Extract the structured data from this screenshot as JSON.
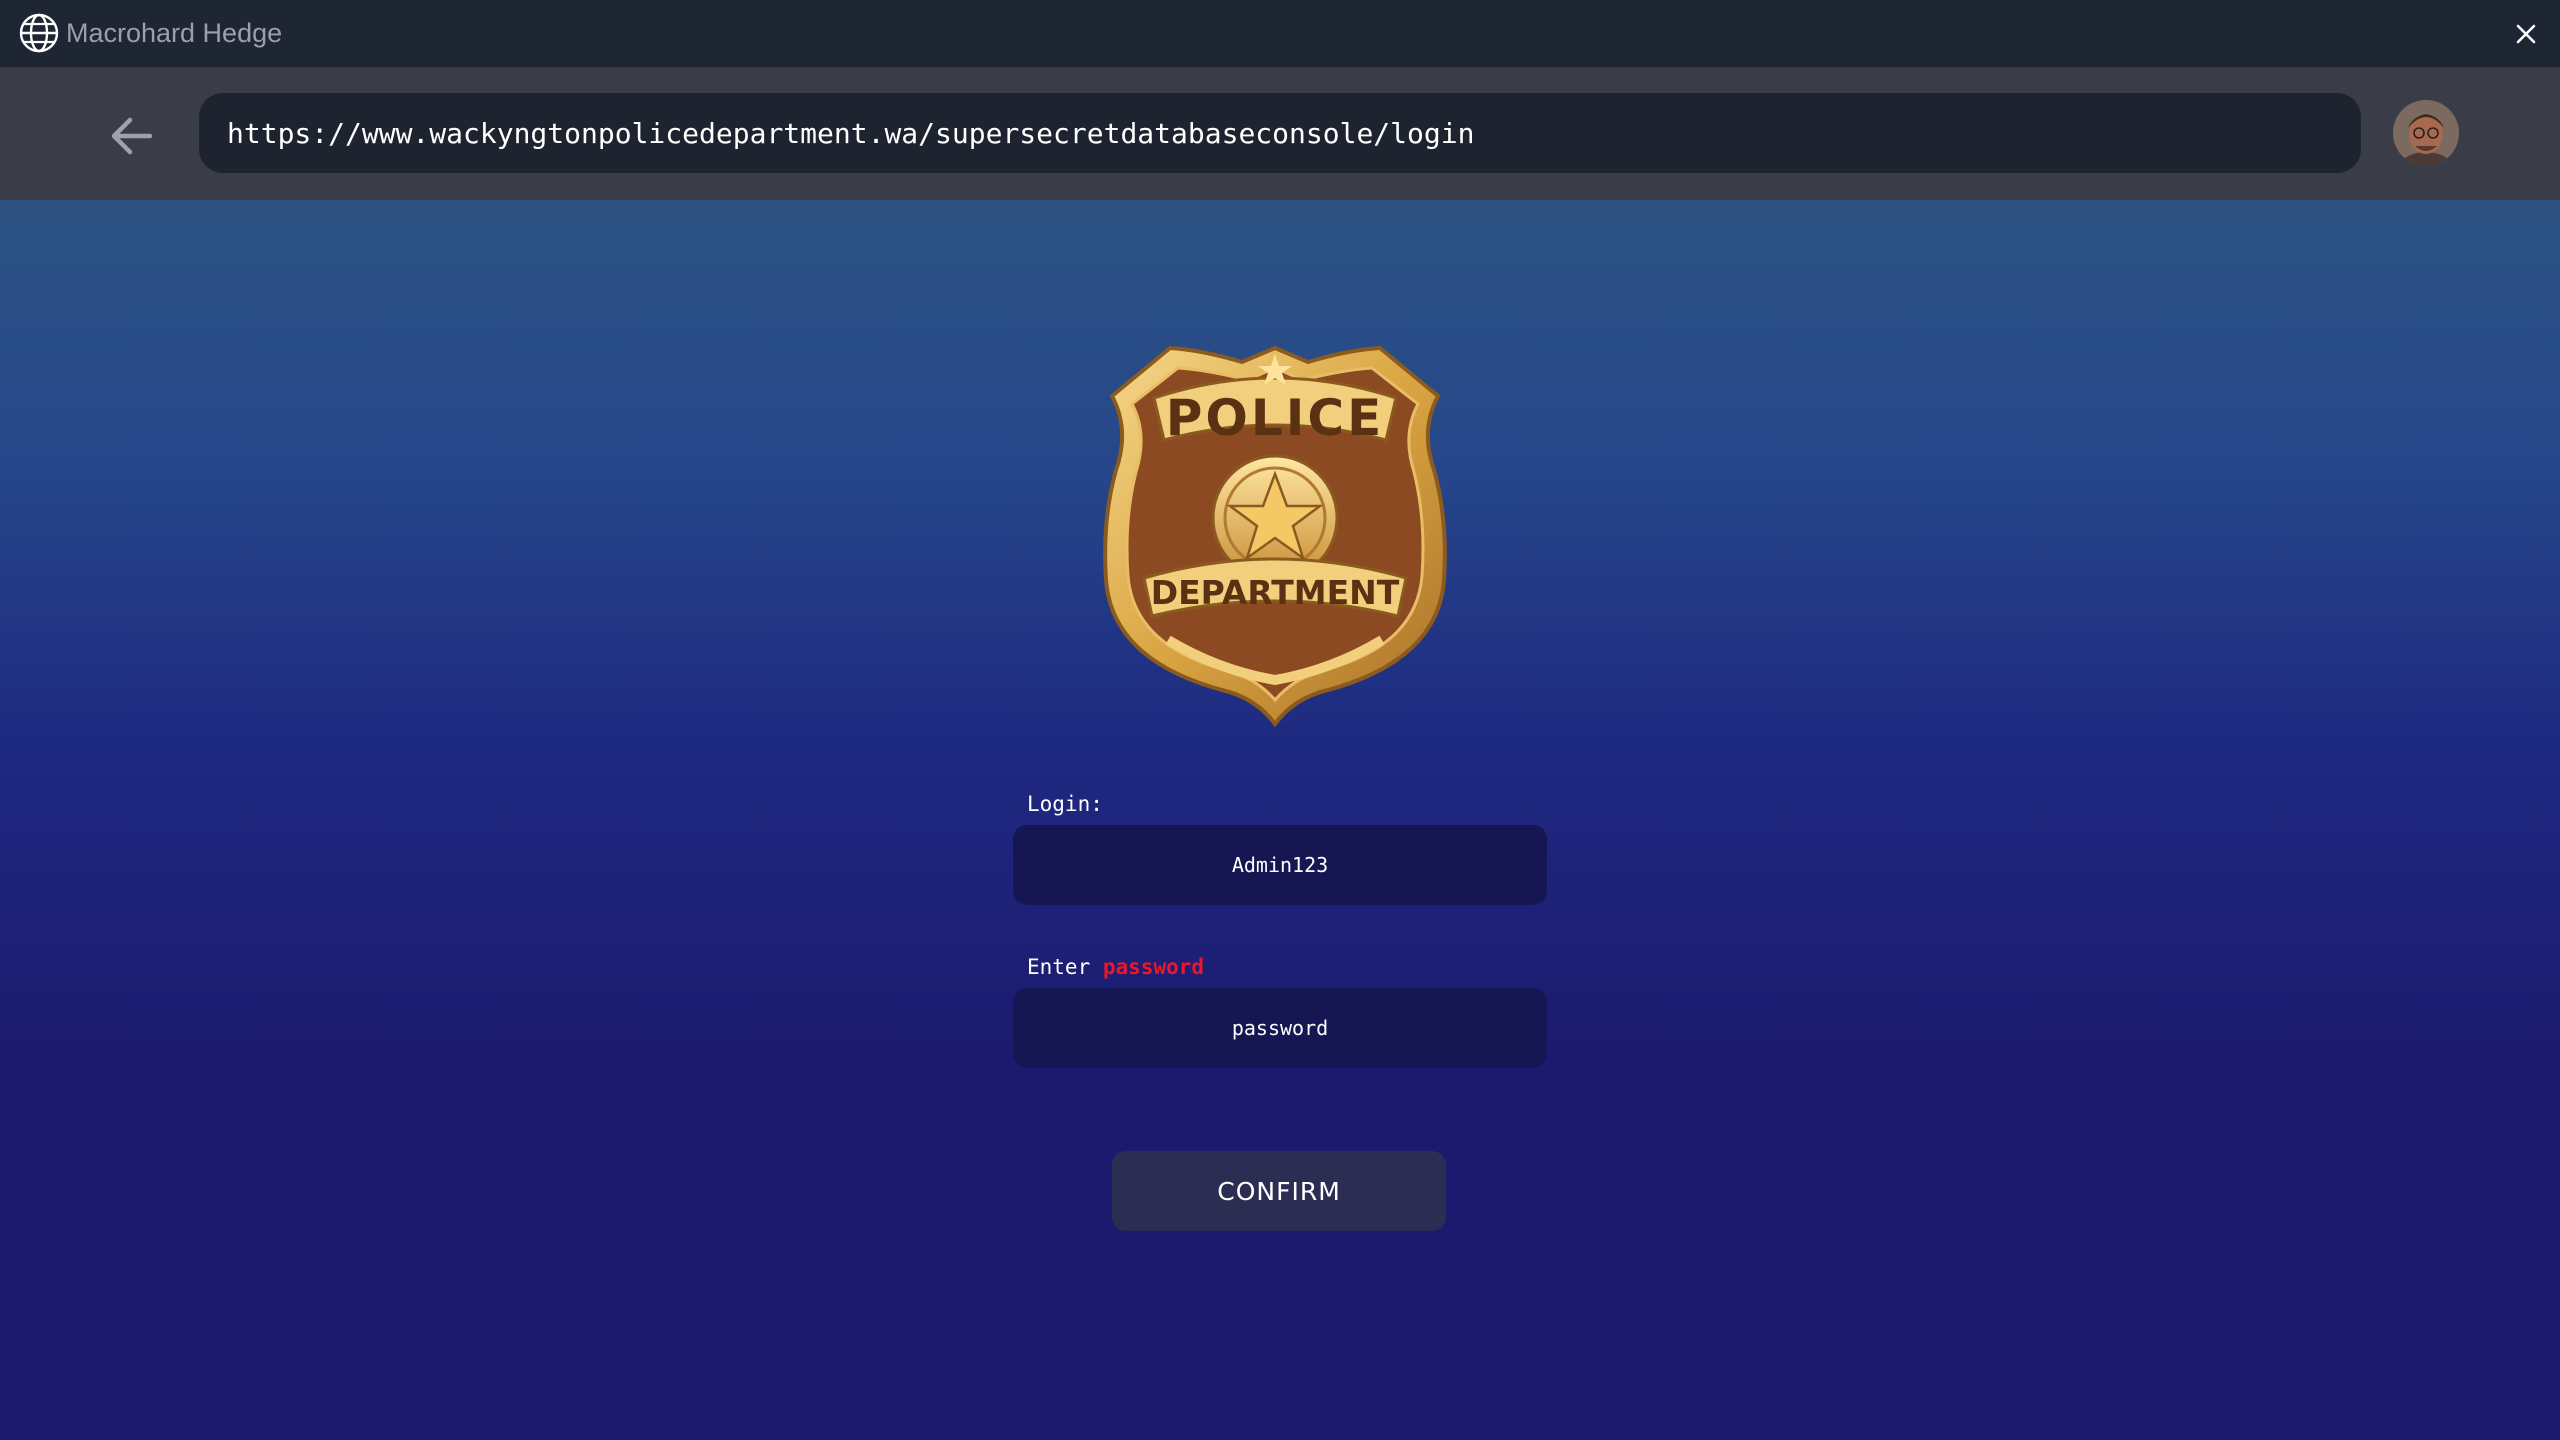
{
  "window": {
    "title": "Macrohard Hedge",
    "app_icon": "globe-icon",
    "close_icon": "close-icon"
  },
  "navbar": {
    "back_icon": "back-arrow-icon",
    "url": "https://www.wackyngtonpolicedepartment.wa/supersecretdatabaseconsole/login",
    "avatar": "user-avatar"
  },
  "page": {
    "logo": {
      "top_text": "POLICE",
      "bottom_text": "DEPARTMENT"
    },
    "login_label": "Login:",
    "login_value": "Admin123",
    "password_label_prefix": "Enter",
    "password_label_accent": "password",
    "password_value": "password",
    "confirm_label": "CONFIRM"
  },
  "colors": {
    "accent_red": "#e8182e",
    "gold": "#d9a441",
    "background_top": "#2c5282",
    "background_bottom": "#1c1a6e"
  }
}
